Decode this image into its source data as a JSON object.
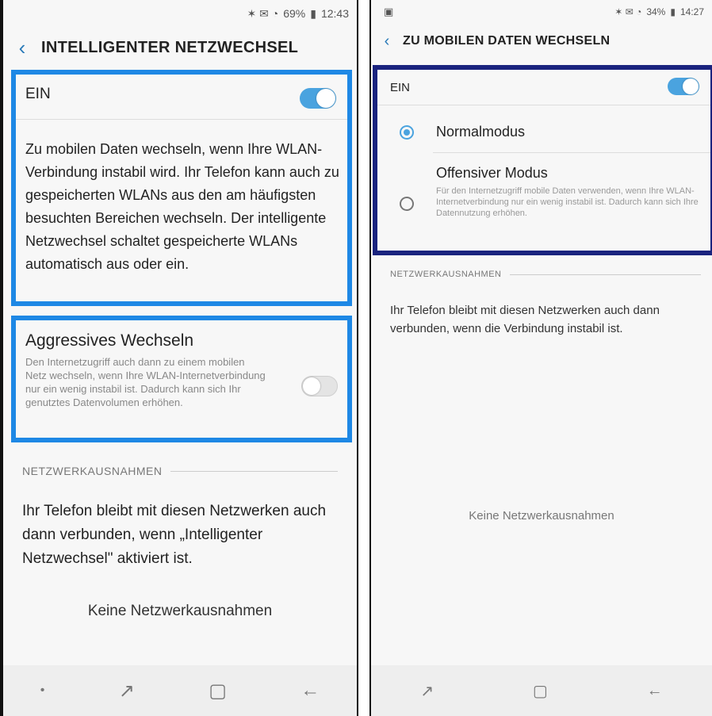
{
  "left": {
    "status": {
      "icons": "✶ ✉ ◔",
      "battery": "69%",
      "time": "12:43"
    },
    "title": "INTELLIGENTER NETZWECHSEL",
    "main_toggle": {
      "label": "EIN",
      "state": "on"
    },
    "description": "Zu mobilen Daten wechseln, wenn Ihre WLAN-Verbindung instabil wird. Ihr Telefon kann auch zu gespeicherten WLANs aus den am häufigsten besuchten Bereichen wechseln. Der intelligente Netzwechsel schaltet gespeicherte WLANs automatisch aus oder ein.",
    "aggressive": {
      "title": "Aggressives Wechseln",
      "description": "Den Internetzugriff auch dann zu einem mobilen Netz wechseln, wenn Ihre WLAN-Internetverbindung nur ein wenig instabil ist. Dadurch kann sich Ihr genutztes Datenvolumen erhöhen.",
      "state": "off"
    },
    "exceptions_header": "NETZWERKAUSNAHMEN",
    "exceptions_text": "Ihr Telefon bleibt mit diesen Netzwerken auch dann verbunden, wenn „Intelligenter Netzwechsel\" aktiviert ist.",
    "exceptions_empty": "Keine Netzwerkausnahmen"
  },
  "right": {
    "status": {
      "icons": "✶ ✉ ◔",
      "battery": "34%",
      "time": "14:27"
    },
    "title": "ZU MOBILEN DATEN WECHSELN",
    "main_toggle": {
      "label": "EIN",
      "state": "on"
    },
    "modes": [
      {
        "label": "Normalmodus",
        "selected": true
      },
      {
        "label": "Offensiver Modus",
        "description": "Für den Internetzugriff mobile Daten verwenden, wenn Ihre WLAN-Internetverbindung nur ein wenig instabil ist. Dadurch kann sich Ihre Datennutzung erhöhen.",
        "selected": false
      }
    ],
    "exceptions_header": "NETZWERKAUSNAHMEN",
    "exceptions_text": "Ihr Telefon bleibt mit diesen Netzwerken auch dann verbunden, wenn die Verbindung instabil ist.",
    "exceptions_empty": "Keine Netzwerkausnahmen"
  },
  "nav": {
    "recent_icon": "↗",
    "home_icon": "▢",
    "back_icon": "←",
    "dot": "•"
  },
  "colors": {
    "highlight_left": "#1e88e5",
    "highlight_right": "#1a237e",
    "accent": "#4aa3df"
  }
}
